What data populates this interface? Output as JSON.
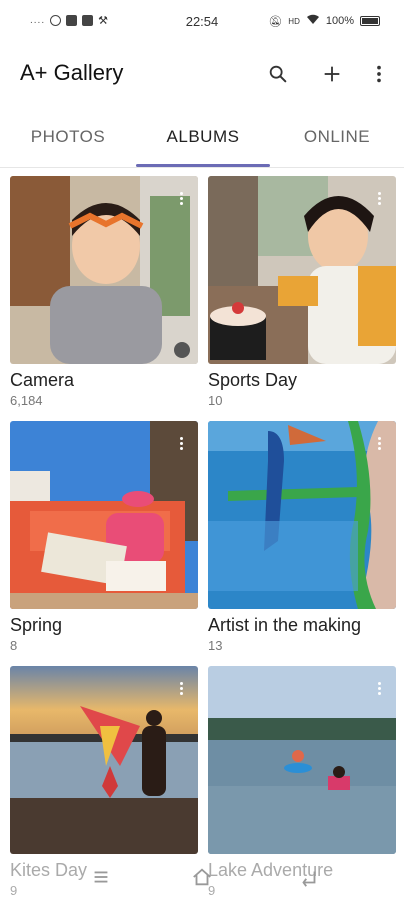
{
  "status_bar": {
    "time": "22:54",
    "battery": "100%",
    "left_icons": [
      "signal-dots",
      "location-icon",
      "image-icon",
      "mail-icon",
      "tools-icon"
    ],
    "right_icons": [
      "mute-icon",
      "hd-icon",
      "wifi-icon",
      "battery-icon"
    ]
  },
  "app_bar": {
    "title": "A+ Gallery",
    "actions": [
      "search-icon",
      "add-icon",
      "more-vert-icon"
    ]
  },
  "tabs": [
    {
      "label": "PHOTOS",
      "active": false
    },
    {
      "label": "ALBUMS",
      "active": true
    },
    {
      "label": "ONLINE",
      "active": false
    }
  ],
  "albums": [
    {
      "name": "Camera",
      "count": "6,184"
    },
    {
      "name": "Sports Day",
      "count": "10"
    },
    {
      "name": "Spring",
      "count": "8"
    },
    {
      "name": "Artist in the making",
      "count": "13"
    },
    {
      "name": "Kites Day",
      "count": "9"
    },
    {
      "name": "Lake Adventure",
      "count": "9"
    }
  ],
  "nav_bar": [
    "menu-icon",
    "home-icon",
    "back-icon"
  ],
  "colors": {
    "accent": "#6b6bb5",
    "text": "#222222",
    "muted": "#777777"
  }
}
